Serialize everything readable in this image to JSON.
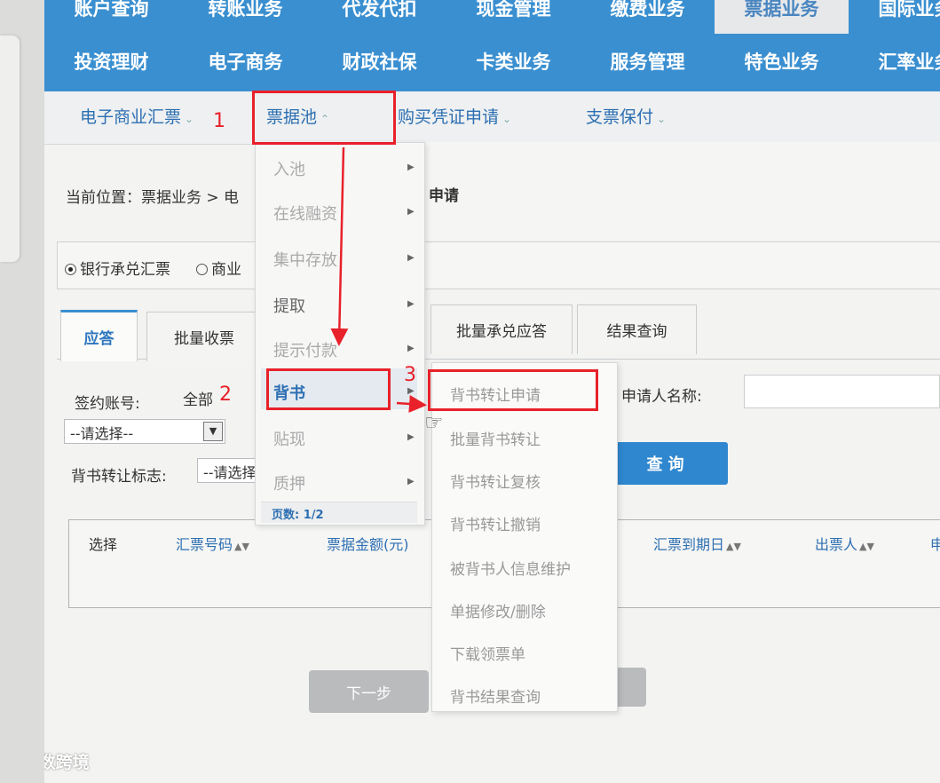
{
  "watermark": {
    "text": "大数跨境"
  },
  "nav": {
    "row1": [
      "账户查询",
      "转账业务",
      "代发代扣",
      "现金管理",
      "缴费业务",
      "票据业务",
      "国际业务"
    ],
    "row1_active_index": 5,
    "row2": [
      "投资理财",
      "电子商务",
      "财政社保",
      "卡类业务",
      "服务管理",
      "特色业务",
      "汇率业务"
    ]
  },
  "subnav": {
    "items": [
      "电子商业汇票",
      "票据池",
      "购买凭证申请",
      "支票保付"
    ]
  },
  "breadcrumb": {
    "text": "当前位置：票据业务 > 电",
    "suffix": "申请"
  },
  "radio": {
    "options": [
      "银行承兑汇票",
      "商业"
    ],
    "selected_index": 0
  },
  "tabs": [
    "应答",
    "批量收票",
    "批量承兑应答",
    "结果查询"
  ],
  "form": {
    "account_label": "签约账号:",
    "account_value": "全部",
    "select_placeholder": "--请选择--",
    "endorse_flag_label": "背书转让标志:",
    "endorse_flag_value": "--请选择",
    "applicant_label": "申请人名称:",
    "query_button": "查询"
  },
  "table": {
    "headers": [
      "选择",
      "汇票号码",
      "票据金额(元)",
      "汇票到期日",
      "出票人",
      "申"
    ]
  },
  "next_button": "下一步",
  "menu_bill_pool": {
    "items": [
      "入池",
      "在线融资",
      "集中存放",
      "提取",
      "提示付款",
      "背书",
      "贴现",
      "质押"
    ],
    "highlighted_index": 5,
    "footer": "页数: 1/2"
  },
  "menu_endorse": {
    "items": [
      "背书转让申请",
      "批量背书转让",
      "背书转让复核",
      "背书转让撤销",
      "被背书人信息维护",
      "单据修改/删除",
      "下载领票单",
      "背书结果查询"
    ]
  },
  "annotations": {
    "labels": [
      "1",
      "2",
      "3"
    ],
    "color": "#e8212a"
  },
  "colors": {
    "nav_blue": "#3a8fd0",
    "accent": "#2d6fb2"
  }
}
